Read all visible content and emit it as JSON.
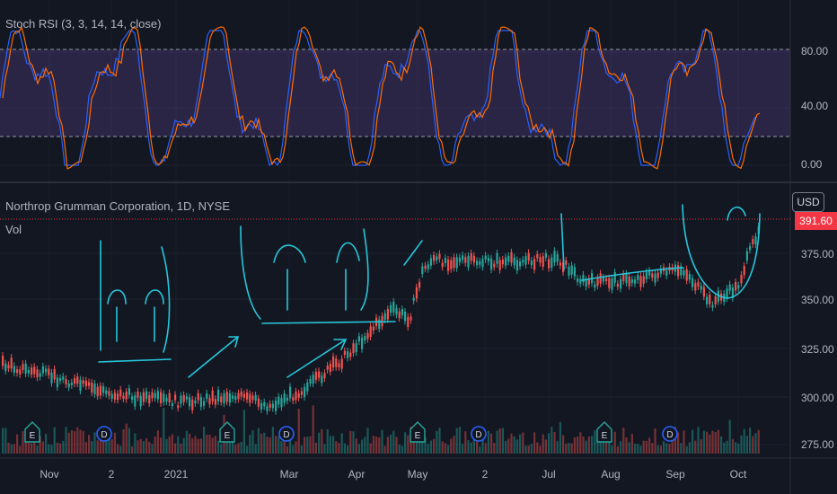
{
  "indicator": {
    "label": "Stoch RSI (3, 3, 14, 14, close)",
    "levels": [
      "80.00",
      "40.00",
      "0.00"
    ]
  },
  "main": {
    "symbol_label": "Northrop Grumman Corporation, 1D, NYSE",
    "volume_label": "Vol",
    "currency": "USD",
    "current_price": "391.60",
    "price_ticks": [
      "375.00",
      "350.00",
      "325.00",
      "300.00",
      "275.00"
    ]
  },
  "x_axis": {
    "ticks": [
      "Nov",
      "2",
      "2021",
      "Mar",
      "Apr",
      "May",
      "2",
      "Jul",
      "Aug",
      "Sep",
      "Oct"
    ]
  },
  "events": {
    "earnings_letter": "E",
    "dividend_letter": "D"
  },
  "colors": {
    "bg": "#131722",
    "up": "#26a69a",
    "down": "#ef5350",
    "stoch_k": "#2962ff",
    "stoch_d": "#ff6d00",
    "band": "#7e57c2",
    "drawing": "#26c6da",
    "accent_price": "#f23645"
  }
}
